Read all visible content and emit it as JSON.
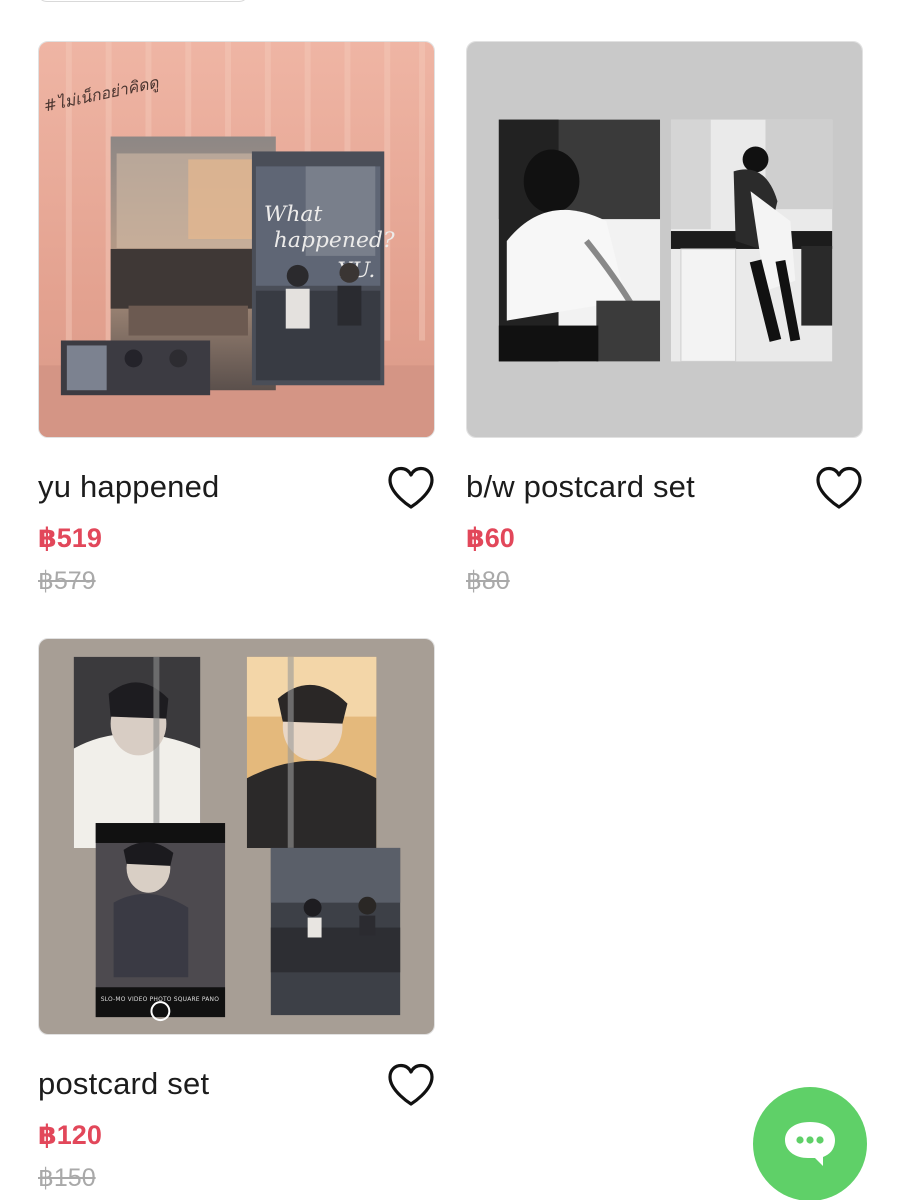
{
  "products": [
    {
      "title": "yu happened",
      "price": "฿519",
      "old_price": "฿579",
      "image": "yu-happened-book-cover",
      "cover_text": "What happened? YU.",
      "hashtag": "#ไม่เน็กอย่าคิดดู"
    },
    {
      "title": "b/w postcard set",
      "price": "฿60",
      "old_price": "฿80",
      "image": "bw-postcard-pair"
    },
    {
      "title": "postcard set",
      "price": "฿120",
      "old_price": "฿150",
      "image": "color-postcard-collage",
      "camera_modes": [
        "SLO-MO",
        "VIDEO",
        "PHOTO",
        "SQUARE",
        "PANO"
      ]
    }
  ],
  "colors": {
    "price": "#e2475a",
    "old_price": "#a9a9a9",
    "chat_button": "#5fd068"
  },
  "icons": {
    "favorite": "heart-outline-icon",
    "chat": "chat-bubble-icon"
  }
}
